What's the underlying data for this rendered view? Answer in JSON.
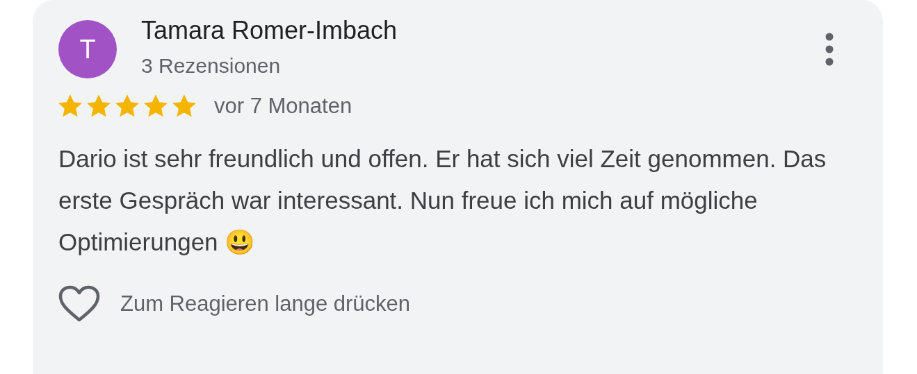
{
  "review": {
    "avatar": {
      "letter": "T",
      "color": "#a152c4"
    },
    "author": "Tamara Romer-Imbach",
    "review_count": "3 Rezensionen",
    "stars": 5,
    "time": "vor 7 Monaten",
    "text": "Dario ist sehr freundlich und offen. Er hat sich viel Zeit genommen. Das erste Gespräch war interessant. Nun freue ich mich auf mögliche Optimierungen 😃",
    "reaction_hint": "Zum Reagieren lange drücken"
  }
}
